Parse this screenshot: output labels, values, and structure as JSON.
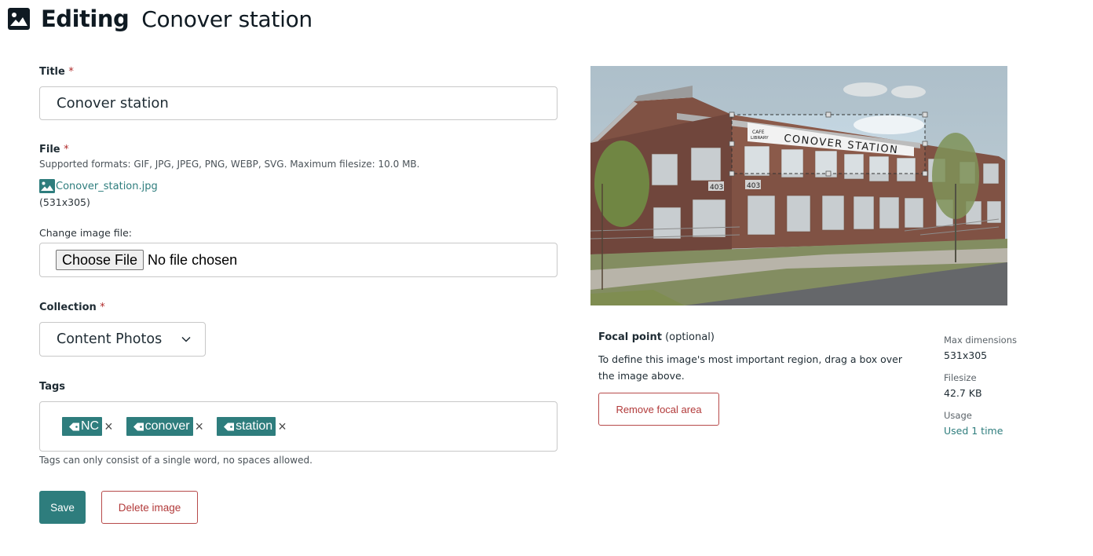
{
  "header": {
    "icon": "image-icon",
    "editing_label": "Editing",
    "title": "Conover station"
  },
  "form": {
    "title_field": {
      "label": "Title",
      "required_mark": "*",
      "value": "Conover station"
    },
    "file_field": {
      "label": "File",
      "required_mark": "*",
      "help": "Supported formats: GIF, JPG, JPEG, PNG, WEBP, SVG. Maximum filesize: 10.0 MB.",
      "current_file_icon": "image-icon",
      "current_file_name": "Conover_station.jpg",
      "current_file_dimensions": "(531x305)"
    },
    "change_file": {
      "label": "Change image file:",
      "button_label": "Choose File",
      "status": "No file chosen"
    },
    "collection": {
      "label": "Collection",
      "required_mark": "*",
      "selected": "Content Photos",
      "icon": "chevron-down-icon"
    },
    "tags": {
      "label": "Tags",
      "items": [
        {
          "label": "NC",
          "remove": "×"
        },
        {
          "label": "conover",
          "remove": "×"
        },
        {
          "label": "station",
          "remove": "×"
        }
      ],
      "help": "Tags can only consist of a single word, no spaces allowed."
    },
    "actions": {
      "save_label": "Save",
      "delete_label": "Delete image"
    }
  },
  "preview": {
    "alt": "Conover station building photo",
    "sign_text": "CONOVER STATION",
    "sign_small_top": "CAFE",
    "sign_small_bottom": "LIBRARY",
    "number_plate_1": "403",
    "number_plate_2": "403"
  },
  "focal_point": {
    "title": "Focal point",
    "optional": "(optional)",
    "description": "To define this image's most important region, drag a box over the image above.",
    "remove_label": "Remove focal area"
  },
  "meta": {
    "max_dimensions_label": "Max dimensions",
    "max_dimensions_value": "531x305",
    "filesize_label": "Filesize",
    "filesize_value": "42.7 KB",
    "usage_label": "Usage",
    "usage_value": "Used 1 time"
  },
  "colors": {
    "primary": "#2e7d7d",
    "danger": "#b23a3a",
    "text": "#1e2b33"
  }
}
